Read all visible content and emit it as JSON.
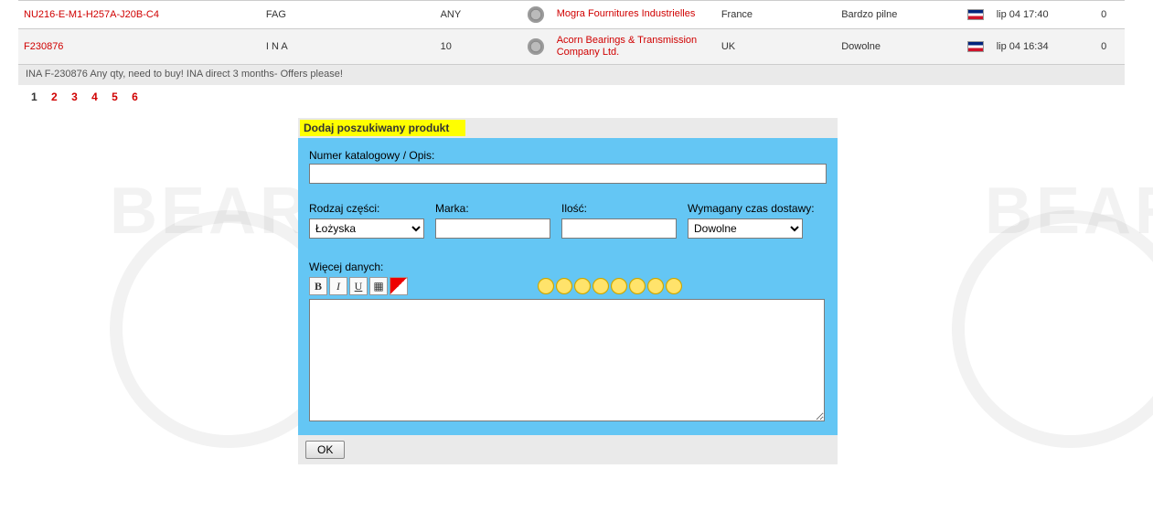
{
  "table": {
    "rows": [
      {
        "code": "NU216-E-M1-H257A-J20B-C4",
        "brand": "FAG",
        "qty": "ANY",
        "company": "Mogra Fournitures Industrielles",
        "country": "France",
        "priority": "Bardzo pilne",
        "date": "lip 04 17:40",
        "count": "0"
      },
      {
        "code": "F230876",
        "brand": "I N A",
        "qty": "10",
        "company": "Acorn Bearings & Transmission Company Ltd.",
        "country": "UK",
        "priority": "Dowolne",
        "date": "lip 04 16:34",
        "count": "0"
      }
    ],
    "note": "INA F-230876 Any qty, need to buy! INA direct 3 months- Offers please!"
  },
  "pagination": {
    "current": "1",
    "pages": [
      "2",
      "3",
      "4",
      "5",
      "6"
    ]
  },
  "form": {
    "header": "Dodaj poszukiwany produkt",
    "catalog_label": "Numer katalogowy / Opis:",
    "part_type_label": "Rodzaj części:",
    "part_type_value": "Łożyska",
    "brand_label": "Marka:",
    "qty_label": "Ilość:",
    "delivery_label": "Wymagany czas dostawy:",
    "delivery_value": "Dowolne",
    "more_data_label": "Więcej danych:",
    "ok_label": "OK"
  },
  "watermark": "BEARI"
}
